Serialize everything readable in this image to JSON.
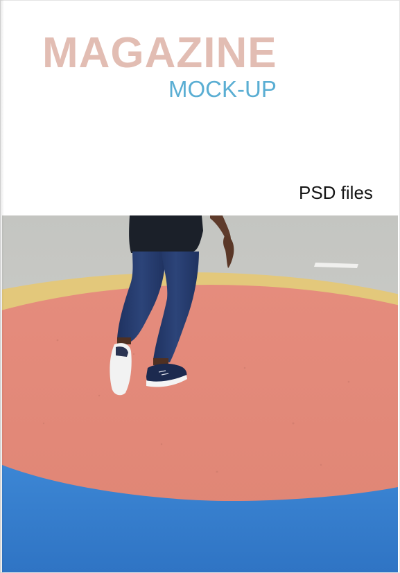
{
  "cover": {
    "title": "MAGAZINE",
    "subtitle": "MOCK-UP",
    "tagline": "PSD files"
  },
  "colors": {
    "title": "#e2bdb3",
    "subtitle": "#5aaed3",
    "tagline": "#141414",
    "pavement": "#c9cac6",
    "yellow_ring": "#e2c77a",
    "red_circle": "#e0897a",
    "blue_ground": "#3b84d2",
    "jeans": "#253a6b",
    "shirt": "#1b2029",
    "skin": "#5e3b2b"
  },
  "photo": {
    "subject": "person walking on painted circle",
    "elements": [
      "pavement",
      "yellow-ring",
      "red-circle",
      "blue-ground",
      "walking-person",
      "road-marking"
    ]
  }
}
